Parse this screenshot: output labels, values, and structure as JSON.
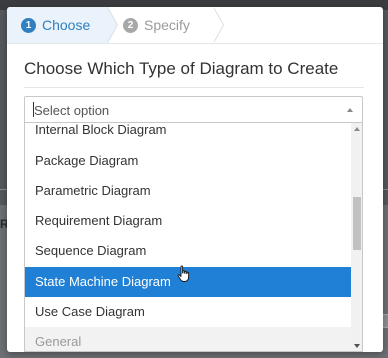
{
  "background": {
    "partial_label": "Re"
  },
  "wizard": {
    "steps": [
      {
        "number": "1",
        "label": "Choose"
      },
      {
        "number": "2",
        "label": "Specify"
      }
    ]
  },
  "dialog": {
    "title": "Choose Which Type of Diagram to Create"
  },
  "select": {
    "placeholder": "Select option"
  },
  "dropdown": {
    "options": [
      {
        "label": "Internal Block Diagram",
        "state": "partially-visible"
      },
      {
        "label": "Package Diagram",
        "state": "normal"
      },
      {
        "label": "Parametric Diagram",
        "state": "normal"
      },
      {
        "label": "Requirement Diagram",
        "state": "normal"
      },
      {
        "label": "Sequence Diagram",
        "state": "normal"
      },
      {
        "label": "State Machine Diagram",
        "state": "highlighted"
      },
      {
        "label": "Use Case Diagram",
        "state": "normal"
      },
      {
        "label": "General",
        "state": "group-header"
      }
    ]
  },
  "colors": {
    "accent": "#1f80d6",
    "step_active_bg": "#eaf2fb",
    "step_active_text": "#2f7fc1"
  },
  "icons": {
    "cursor": "hand-pointer-icon",
    "scroll_up": "scroll-up-arrow-icon",
    "scroll_down": "scroll-down-arrow-icon",
    "select_toggle": "caret-up-icon"
  }
}
